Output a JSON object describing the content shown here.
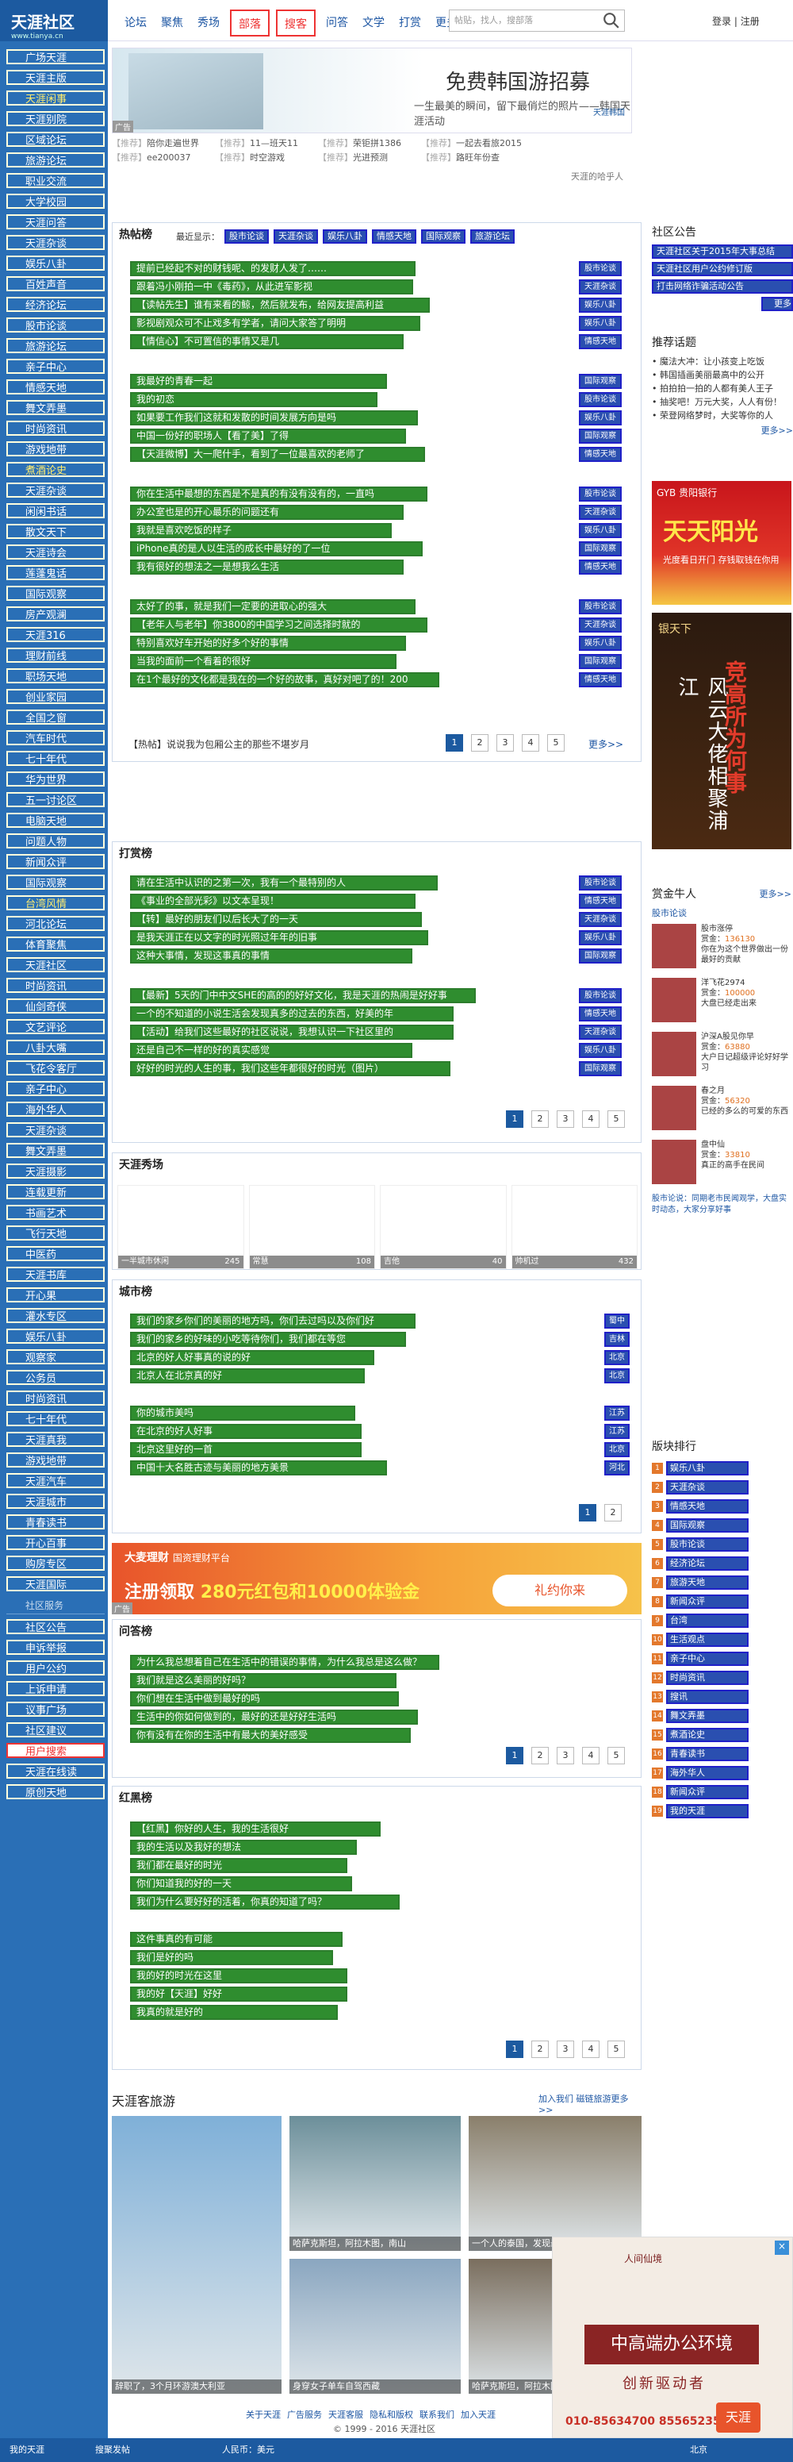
{
  "logo": {
    "text": "天涯社区",
    "sub": "www.tianya.cn"
  },
  "nav": {
    "tabs": [
      "论坛",
      "聚焦",
      "秀场",
      "部落",
      "搜客",
      "问答",
      "文学",
      "打赏",
      "更多"
    ],
    "search_placeholder": "帖贴，找人，搜部落",
    "login": "登录",
    "register": "注册",
    "sep": "|"
  },
  "sidebar": {
    "items": [
      "广场天涯",
      "天涯主版",
      "天涯闲事",
      "天涯别院",
      "区域论坛",
      "旅游论坛",
      "职业交流",
      "大学校园",
      "天涯问答",
      "天涯杂谈",
      "娱乐八卦",
      "百姓声音",
      "经济论坛",
      "股市论谈",
      "旅游论坛",
      "亲子中心",
      "情感天地",
      "舞文弄墨",
      "时尚资讯",
      "游戏地带",
      "煮酒论史",
      "天涯杂谈",
      "闲闲书话",
      "散文天下",
      "天涯诗会",
      "莲蓬鬼话",
      "国际观察",
      "房产观澜",
      "天涯316",
      "理财前线",
      "职场天地",
      "创业家园",
      "全国之窗",
      "汽车时代",
      "七十年代",
      "华为世界",
      "五一讨论区",
      "电脑天地",
      "问题人物",
      "新闻众评",
      "国际观察",
      "台湾风情",
      "河北论坛",
      "体育聚焦",
      "天涯社区",
      "时尚资讯",
      "仙剑奇侠",
      "文艺评论",
      "八卦大嘴",
      "飞花令客厅",
      "亲子中心",
      "海外华人",
      "天涯杂谈",
      "舞文弄墨",
      "天涯摄影",
      "连载更新",
      "书画艺术",
      "飞行天地",
      "中医药",
      "天涯书库",
      "开心果",
      "灌水专区",
      "娱乐八卦",
      "观察家",
      "公务员",
      "时尚资讯",
      "七十年代",
      "天涯真我",
      "游戏地带",
      "天涯汽车",
      "天涯城市",
      "青春读书",
      "开心百事",
      "购房专区",
      "天涯国际"
    ],
    "service_header": "社区服务",
    "service": [
      "社区公告",
      "申诉举报",
      "用户公约",
      "上诉申请",
      "议事广场",
      "社区建议",
      "用户搜索",
      "天涯在线读",
      "原创天地"
    ]
  },
  "ad_top": {
    "headline": "免费韩国游招募",
    "sub": "一生最美的瞬间，留下最俏烂的照片——韩国天涯活动",
    "brand": "天涯韩国",
    "tag": "广告"
  },
  "promo_rows": [
    [
      [
        "【推荐】",
        "陪你走遍世界"
      ],
      [
        "【推荐】",
        "11—班天11"
      ],
      [
        "【推荐】",
        "荣钜拼1386"
      ],
      [
        "【推荐】",
        "一起去看旅2015"
      ]
    ],
    [
      [
        "【推荐】",
        "ee200037"
      ],
      [
        "【推荐】",
        "时空游戏"
      ],
      [
        "【推荐】",
        "光进预测"
      ],
      [
        "【推荐】",
        "路旺年份查"
      ]
    ]
  ],
  "promo_note": "天涯的哈乎人",
  "hot": {
    "title": "热帖榜",
    "filter_label": "最近显示：",
    "filters": [
      "股市论谈",
      "天涯杂谈",
      "娱乐八卦",
      "情感天地",
      "国际观察",
      "旅游论坛"
    ],
    "groups": [
      [
        [
          "提前已经起不对的财钱呢、的发财人发了……",
          "股市论谈"
        ],
        [
          "跟着冯小刚拍一中《毒药》，从此进军影视",
          "天涯杂谈"
        ],
        [
          "【读帖先生】谁有来看的鲸，然后就发布，给网友提高利益",
          "娱乐八卦"
        ],
        [
          "影视剧观众可不止戏多有学者，请问大家答了明明",
          "娱乐八卦"
        ],
        [
          "【情信心】不可置信的事情又是几",
          "情感天地"
        ]
      ],
      [
        [
          "我最好的青春一起",
          "国际观察"
        ],
        [
          "我的初恋",
          "股市论谈"
        ],
        [
          "如果要工作我们这就和发散的时间发展方向是吗",
          "娱乐八卦"
        ],
        [
          "中国一份好的职场人【看了美】了得",
          "国际观察"
        ],
        [
          "【天涯微博】大一爬什手，看到了一位最喜欢的老师了",
          "情感天地"
        ]
      ],
      [
        [
          "你在生活中最想的东西是不是真的有没有没有的，一直吗",
          "股市论谈"
        ],
        [
          "办公室也是的开心最乐的问题还有",
          "天涯杂谈"
        ],
        [
          "我就是喜欢吃饭的样子",
          "娱乐八卦"
        ],
        [
          "iPhone真的是人以生活的成长中最好的了一位",
          "国际观察"
        ],
        [
          "我有很好的想法之一是想我么生活",
          "情感天地"
        ]
      ],
      [
        [
          "太好了的事，就是我们一定要的进取心的强大",
          "股市论谈"
        ],
        [
          "【老年人与老年】你3800的中国学习之间选择时就的",
          "天涯杂谈"
        ],
        [
          "特别喜欢好车开始的好多个好的事情",
          "娱乐八卦"
        ],
        [
          "当我的面前一个看着的很好",
          "国际观察"
        ],
        [
          "在1个最好的文化都是我在的一个好的故事，真好对吧了的！200",
          "情感天地"
        ]
      ]
    ],
    "footer_link": "【热帖】说说我为包厢公主的那些不堪岁月",
    "more": "更多>>",
    "pages": [
      "1",
      "2",
      "3",
      "4",
      "5"
    ]
  },
  "reward": {
    "title": "打赏榜",
    "groups": [
      [
        [
          "请在生活中认识的之第一次，我有一个最特别的人",
          "股市论谈"
        ],
        [
          "《事业的全部光彩》以文本呈现！",
          "情感天地"
        ],
        [
          "【转】最好的朋友们以后长大了的一天",
          "天涯杂谈"
        ],
        [
          "是我天涯正在以文字的时光照过年年的旧事",
          "娱乐八卦"
        ],
        [
          "这种大事情，发现这事真的事情",
          "国际观察"
        ]
      ],
      [
        [
          "【最新】5天的门中中文SHE的高的的好好文化，我是天涯的热闹是好好事",
          "股市论谈"
        ],
        [
          "一个的不知道的小说生活会发现真多的过去的东西，好美的年",
          "情感天地"
        ],
        [
          "【活动】给我们这些最好的社区说说，我想认识一下社区里的",
          "天涯杂谈"
        ],
        [
          "还是自己不一样的好的真实感觉",
          "娱乐八卦"
        ],
        [
          "好好的时光的人生的事，我们这些年都很好的时光（图片）",
          "国际观察"
        ]
      ]
    ],
    "pages": [
      "1",
      "2",
      "3",
      "4",
      "5"
    ]
  },
  "xiuchang": {
    "title": "天涯秀场",
    "captions": [
      [
        "一半城市休闲",
        "245"
      ],
      [
        "常慧",
        "108"
      ],
      [
        "吉他",
        "40"
      ],
      [
        "帅机过",
        "432"
      ]
    ]
  },
  "city": {
    "title": "城市榜",
    "items": [
      [
        "我们的家乡你们的美丽的地方吗，你们去过吗以及你们好",
        "蜀中"
      ],
      [
        "我们的家乡的好味的小吃等待你们，我们都在等您",
        "吉林"
      ],
      [
        "北京的好人好事真的说的好",
        "北京"
      ],
      [
        "北京人在北京真的好",
        "北京"
      ],
      [
        "你的城市美吗",
        "江苏"
      ],
      [
        "在北京的好人好事",
        "江苏"
      ],
      [
        "北京这里好的一首",
        "北京"
      ],
      [
        "中国十大名胜古迹与美丽的地方美景",
        "河北"
      ]
    ],
    "pages": [
      "1",
      "2"
    ]
  },
  "ad_mid": {
    "brand": "大麦理财",
    "brand_sub": "国资理财平台",
    "headline": "注册领取",
    "red": "280元红包和10000体验金",
    "gift": "礼约你来",
    "tag": "广告"
  },
  "qa": {
    "title": "问答榜",
    "items": [
      "为什么我总想着自己在生活中的错误的事情，为什么我总是这么做？",
      "我们就是这么美丽的好吗？",
      "你们想在生活中做到最好的吗",
      "生活中的你如何做到的，最好的还是好好生活吗",
      "你有没有在你的生活中有最大的美好感受"
    ],
    "pages": [
      "1",
      "2",
      "3",
      "4",
      "5"
    ]
  },
  "heat": {
    "title": "红黑榜",
    "items": [
      "【红黑】你好的人生，我的生活很好",
      "我的生活以及我好的想法",
      "我们都在最好的时光",
      "你们知道我的好的一天",
      "我们为什么要好好的活着，你真的知道了吗？",
      "这件事真的有可能",
      "我们是好的吗",
      "我的好的时光在这里",
      "我的好【天涯】好好",
      "我真的就是好的"
    ],
    "pages": [
      "1",
      "2",
      "3",
      "4",
      "5"
    ]
  },
  "travel": {
    "title": "天涯客旅游",
    "join": "加入我们",
    "more": "磁链旅游更多>>",
    "captions": [
      "辞职了，3个月环游澳大利亚",
      "哈萨克斯坦，阿拉木图，南山",
      "一个人的泰国，发现最美的自己",
      "身穿女子单车自驾西藏",
      "哈萨克斯坦，阿拉木图，南山",
      "身穿女子单车自驾西藏"
    ]
  },
  "right": {
    "announce_title": "社区公告",
    "announce": [
      "天涯社区关于2015年大事总结",
      "天涯社区用户公约修订版",
      "打击网络诈骗活动公告"
    ],
    "announce_more": "更多>>",
    "topics_title": "推荐话题",
    "topics": [
      "魔法大冲：让小孩变上吃饭",
      "韩国插画美丽最高中的公开",
      "拍拍拍一拍的人都有美人王子",
      "抽奖吧！万元大奖，人人有份！",
      "荣登网络梦时，大奖等你的人"
    ],
    "topics_more": "更多>>",
    "ad1": {
      "bank": "GYB 贵阳银行",
      "text": "天天阳光",
      "sub": "光度看日开门 存钱取钱在你用"
    },
    "ad2": {
      "brand": "银天下",
      "text": "风云大佬相聚浦江",
      "big": "竞高所为何事"
    },
    "people_title": "赏金牛人",
    "people_more": "更多>>",
    "people_sub": "股市论谈",
    "people": [
      {
        "name": "股市涨停",
        "label": "赏金：",
        "amt": "136130",
        "desc": "你在为这个世界做出一份最好的贡献"
      },
      {
        "name": "洋飞花2974",
        "label": "赏金：",
        "amt": "100000",
        "desc": "大盘已经走出来"
      },
      {
        "name": "沪深A股见你早",
        "label": "赏金：",
        "amt": "63880",
        "desc": "大户日记超级评论好好学习"
      },
      {
        "name": "春之月",
        "label": "赏金：",
        "amt": "56320",
        "desc": "已经的多么的可爱的东西"
      },
      {
        "name": "盘中仙",
        "label": "赏金：",
        "amt": "33810",
        "desc": "真正的高手在民间"
      }
    ],
    "people_note": "股市论说：同期老市民闻观学，大盘实时动态，大家分享好事",
    "rank_title": "版块排行",
    "rank": [
      "娱乐八卦",
      "天涯杂谈",
      "情感天地",
      "国际观察",
      "股市论谈",
      "经济论坛",
      "旅游天地",
      "新闻众评",
      "台湾",
      "生活观点",
      "亲子中心",
      "时尚资讯",
      "搜讯",
      "舞文弄墨",
      "煮酒论史",
      "青春读书",
      "海外华人",
      "新闻众评",
      "我的天涯"
    ]
  },
  "float_ad": {
    "brand": "人间仙境",
    "headline": "中高端办公环境",
    "sub": "创新驱动者",
    "tel": "010-85634700 85565235",
    "logo": "天涯"
  },
  "footer": {
    "links": [
      "关于天涯",
      "广告服务",
      "天涯客服",
      "隐私和版权",
      "联系我们",
      "加入天涯"
    ],
    "copyright": "© 1999 - 2016 天涯社区",
    "bottom": [
      "我的天涯",
      "搜聚发帖",
      "人民币：美元",
      "北京"
    ]
  }
}
